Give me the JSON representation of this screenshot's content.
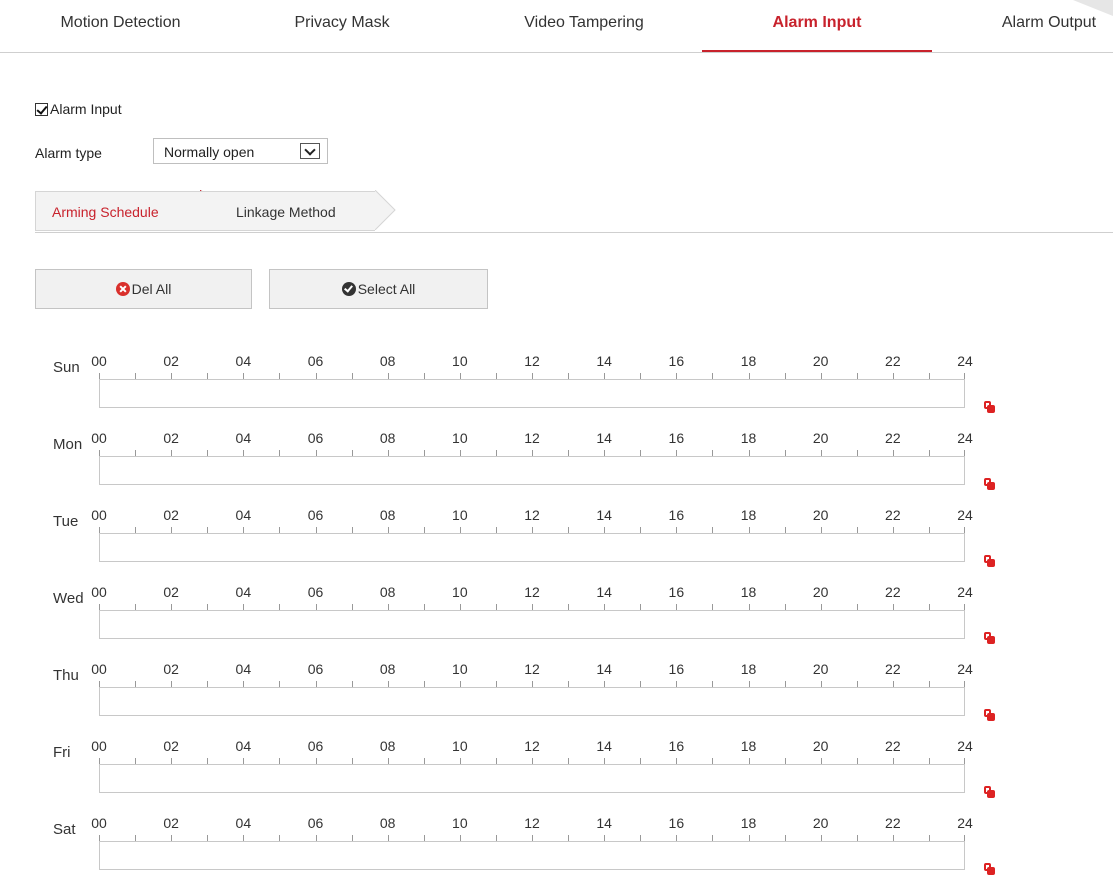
{
  "tabs": [
    {
      "label": "Motion Detection",
      "active": false
    },
    {
      "label": "Privacy Mask",
      "active": false
    },
    {
      "label": "Video Tampering",
      "active": false
    },
    {
      "label": "Alarm Input",
      "active": true
    },
    {
      "label": "Alarm Output",
      "active": false
    }
  ],
  "alarm_input": {
    "checkbox_label": "Alarm Input",
    "checked": true
  },
  "alarm_type": {
    "label": "Alarm type",
    "value": "Normally open"
  },
  "subtabs": [
    {
      "label": "Arming Schedule",
      "active": true
    },
    {
      "label": "Linkage Method",
      "active": false
    }
  ],
  "buttons": {
    "del_all": "Del All",
    "select_all": "Select All"
  },
  "schedule": {
    "hours": [
      "00",
      "02",
      "04",
      "06",
      "08",
      "10",
      "12",
      "14",
      "16",
      "18",
      "20",
      "22",
      "24"
    ],
    "days": [
      "Sun",
      "Mon",
      "Tue",
      "Wed",
      "Thu",
      "Fri",
      "Sat"
    ]
  },
  "colors": {
    "accent": "#c8222c",
    "copy_icon": "#dd2222"
  },
  "icons": {
    "del": "x-circle-icon",
    "select": "check-circle-icon",
    "copy": "copy-icon"
  }
}
